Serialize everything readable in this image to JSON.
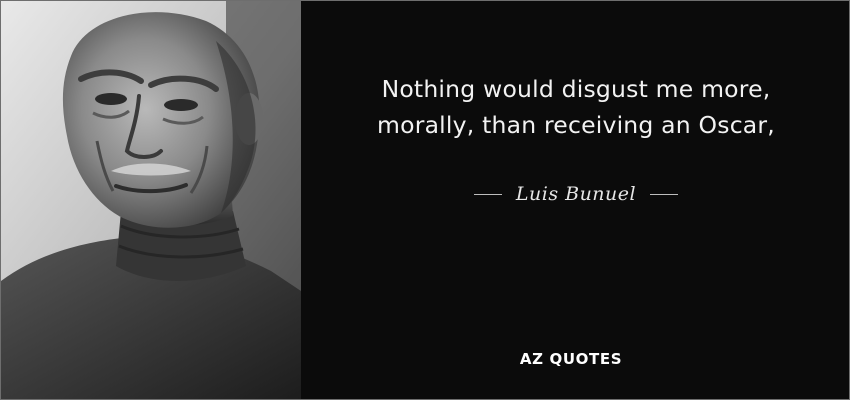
{
  "quote": {
    "line1": "Nothing would disgust me more,",
    "line2": "morally, than receiving an Oscar,"
  },
  "author": "Luis Bunuel",
  "brand": {
    "part1": "AZ",
    "part2": "QUOTES"
  },
  "portrait": {
    "icon": "person-portrait-photo",
    "style": "black-and-white"
  },
  "colors": {
    "background": "#0b0b0b",
    "text": "#f2f2f2",
    "border": "#6e6e6e"
  }
}
